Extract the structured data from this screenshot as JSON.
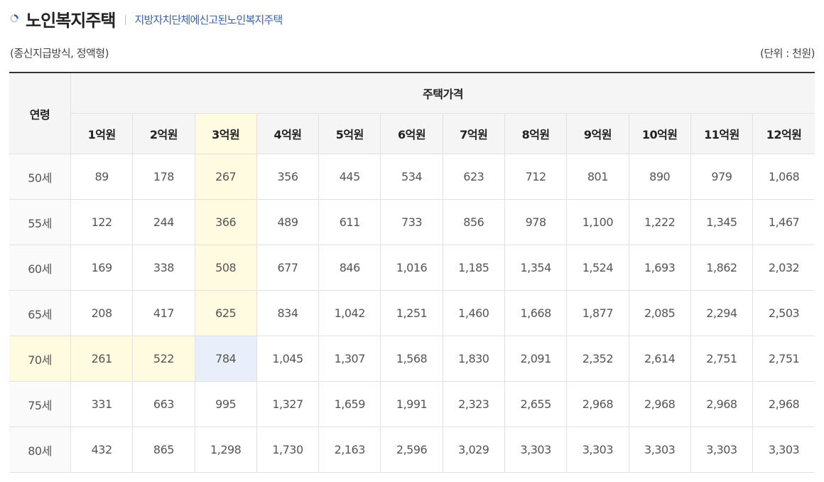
{
  "header": {
    "title": "노인복지주택",
    "subtitle": "지방자치단체에신고된노인복지주택"
  },
  "notes": {
    "method": "(종신지급방식, 정액형)",
    "unit": "(단위 : 천원)"
  },
  "table": {
    "age_header": "연령",
    "price_header": "주택가격",
    "price_columns": [
      "1억원",
      "2억원",
      "3억원",
      "4억원",
      "5억원",
      "6억원",
      "7억원",
      "8억원",
      "9억원",
      "10억원",
      "11억원",
      "12억원"
    ],
    "rows": [
      {
        "age": "50세",
        "values": [
          "89",
          "178",
          "267",
          "356",
          "445",
          "534",
          "623",
          "712",
          "801",
          "890",
          "979",
          "1,068"
        ]
      },
      {
        "age": "55세",
        "values": [
          "122",
          "244",
          "366",
          "489",
          "611",
          "733",
          "856",
          "978",
          "1,100",
          "1,222",
          "1,345",
          "1,467"
        ]
      },
      {
        "age": "60세",
        "values": [
          "169",
          "338",
          "508",
          "677",
          "846",
          "1,016",
          "1,185",
          "1,354",
          "1,524",
          "1,693",
          "1,862",
          "2,032"
        ]
      },
      {
        "age": "65세",
        "values": [
          "208",
          "417",
          "625",
          "834",
          "1,042",
          "1,251",
          "1,460",
          "1,668",
          "1,877",
          "2,085",
          "2,294",
          "2,503"
        ]
      },
      {
        "age": "70세",
        "values": [
          "261",
          "522",
          "784",
          "1,045",
          "1,307",
          "1,568",
          "1,830",
          "2,091",
          "2,352",
          "2,614",
          "2,751",
          "2,751"
        ]
      },
      {
        "age": "75세",
        "values": [
          "331",
          "663",
          "995",
          "1,327",
          "1,659",
          "1,991",
          "2,323",
          "2,655",
          "2,968",
          "2,968",
          "2,968",
          "2,968"
        ]
      },
      {
        "age": "80세",
        "values": [
          "432",
          "865",
          "1,298",
          "1,730",
          "2,163",
          "2,596",
          "3,029",
          "3,303",
          "3,303",
          "3,303",
          "3,303",
          "3,303"
        ]
      }
    ]
  },
  "highlight": {
    "column_color": "#fffbe0",
    "row_color": "#fffbe0",
    "cell_color": "#e8effb"
  }
}
